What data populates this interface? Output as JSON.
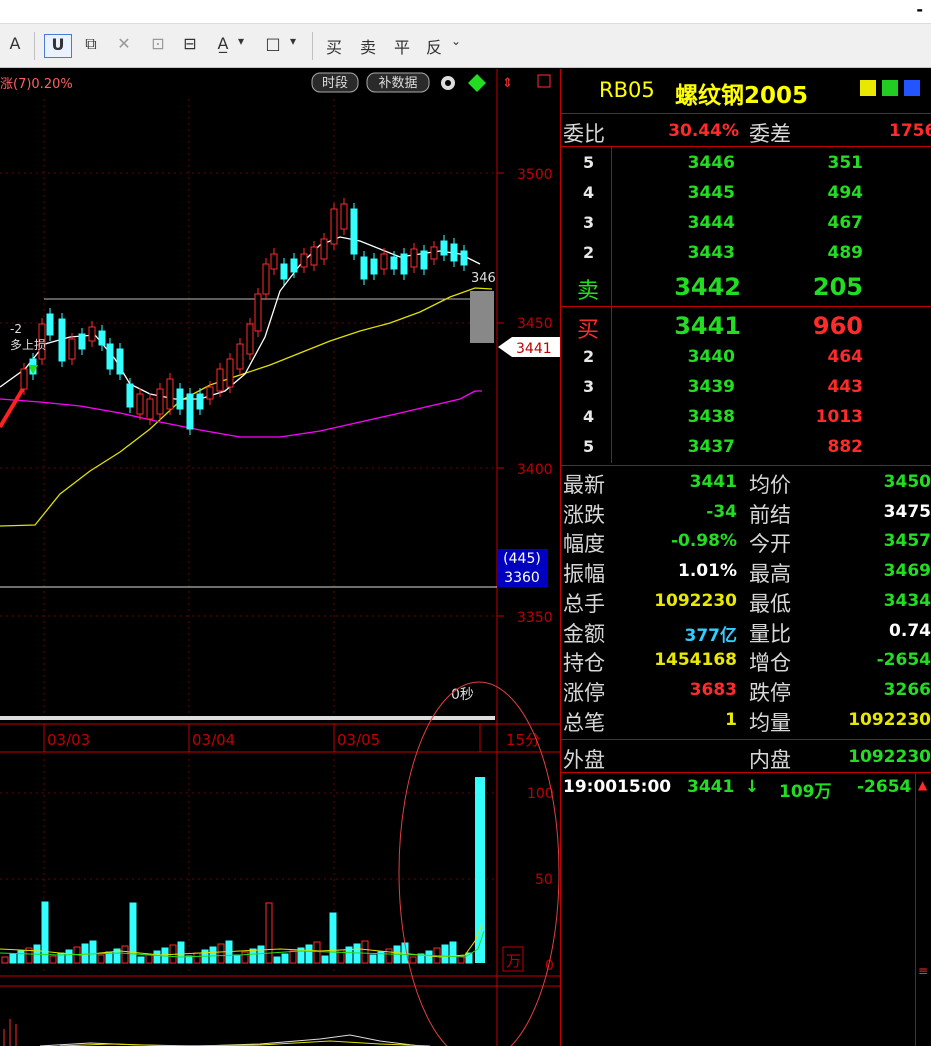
{
  "titlebar": {
    "minimize": "-"
  },
  "toolbar": {
    "items": [
      "A",
      "U",
      "⧉",
      "✕",
      "⊡",
      "⊟",
      "A̲",
      "▾",
      "□",
      "▾",
      "买",
      "卖",
      "平",
      "反",
      "⌄"
    ]
  },
  "chart": {
    "header_text": "涨(7)0.20%",
    "btn_time": "时段",
    "btn_fill": "补数据",
    "price_axis": [
      "3500",
      "3450",
      "3400",
      "3350"
    ],
    "current_price": "3441",
    "right_price_tag": "346",
    "box_top": "(445)",
    "box_bottom": "3360",
    "marker_num": "-2",
    "marker_text": "多上损",
    "seconds_label": "0秒",
    "dates": [
      "03/03",
      "03/04",
      "03/05"
    ],
    "period": "15分",
    "vol_axis": [
      "100",
      "50",
      "0"
    ],
    "vol_unit": "万"
  },
  "quote": {
    "contract_code": "RB05",
    "contract_name": "螺纹钢2005",
    "weibi_label": "委比",
    "weibi_value": "30.44%",
    "weicha_label": "委差",
    "weicha_value": "1756",
    "asks": [
      {
        "level": "5",
        "price": "3446",
        "qty": "351"
      },
      {
        "level": "4",
        "price": "3445",
        "qty": "494"
      },
      {
        "level": "3",
        "price": "3444",
        "qty": "467"
      },
      {
        "level": "2",
        "price": "3443",
        "qty": "489"
      }
    ],
    "ask1": {
      "label": "卖",
      "price": "3442",
      "qty": "205"
    },
    "bid1": {
      "label": "买",
      "price": "3441",
      "qty": "960"
    },
    "bids": [
      {
        "level": "2",
        "price": "3440",
        "qty": "464"
      },
      {
        "level": "3",
        "price": "3439",
        "qty": "443"
      },
      {
        "level": "4",
        "price": "3438",
        "qty": "1013"
      },
      {
        "level": "5",
        "price": "3437",
        "qty": "882"
      }
    ],
    "stats": [
      {
        "l1": "最新",
        "v1": "3441",
        "c1": "green",
        "l2": "均价",
        "v2": "3450",
        "c2": "green"
      },
      {
        "l1": "涨跌",
        "v1": "-34",
        "c1": "green",
        "l2": "前结",
        "v2": "3475",
        "c2": "white"
      },
      {
        "l1": "幅度",
        "v1": "-0.98%",
        "c1": "green",
        "l2": "今开",
        "v2": "3457",
        "c2": "green"
      },
      {
        "l1": "振幅",
        "v1": "1.01%",
        "c1": "white",
        "l2": "最高",
        "v2": "3469",
        "c2": "green"
      },
      {
        "l1": "总手",
        "v1": "1092230",
        "c1": "yellow",
        "l2": "最低",
        "v2": "3434",
        "c2": "green"
      },
      {
        "l1": "金额",
        "v1": "377亿",
        "c1": "cyan",
        "l2": "量比",
        "v2": "0.74",
        "c2": "white"
      },
      {
        "l1": "持仓",
        "v1": "1454168",
        "c1": "yellow",
        "l2": "增仓",
        "v2": "-2654",
        "c2": "green"
      },
      {
        "l1": "涨停",
        "v1": "3683",
        "c1": "red",
        "l2": "跌停",
        "v2": "3266",
        "c2": "green"
      },
      {
        "l1": "总笔",
        "v1": "1",
        "c1": "yellow",
        "l2": "均量",
        "v2": "1092230",
        "c2": "yellow"
      }
    ],
    "outer_label": "外盘",
    "inner_label": "内盘",
    "inner_value": "1092230",
    "tick": {
      "time1": "19:00",
      "time2": "15:00",
      "price": "3441",
      "arrow": "↓",
      "volume": "109万",
      "change": "-2654"
    }
  },
  "colors": {
    "grid_red": "#c00000",
    "up": "#ff2a2a",
    "down": "#33ffff",
    "bg": "#000000"
  }
}
